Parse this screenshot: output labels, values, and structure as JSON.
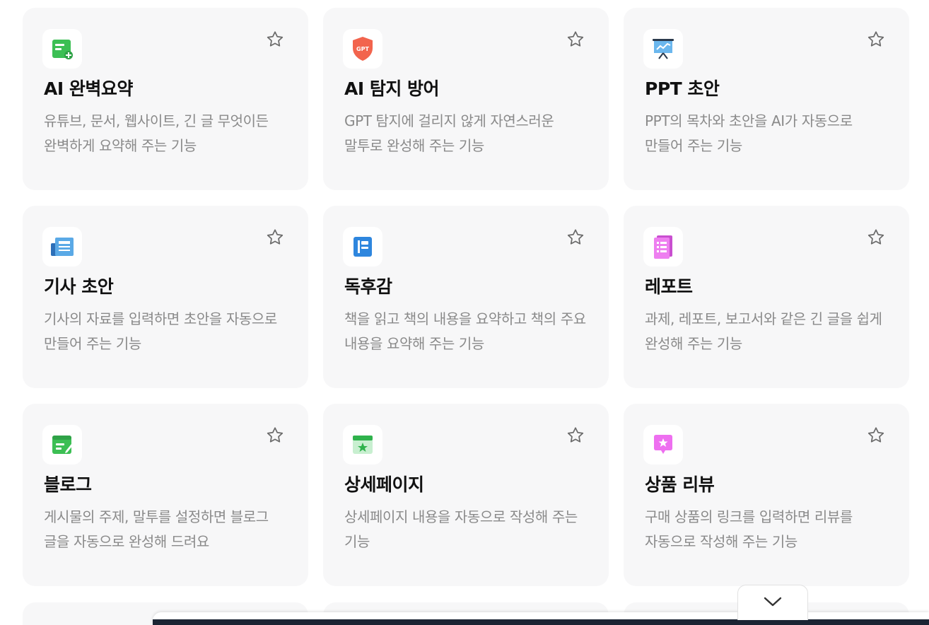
{
  "cards": [
    {
      "title": "AI 완벽요약",
      "desc": "유튜브, 문서, 웹사이트, 긴 글 무엇이든 완벽하게 요약해 주는 기능",
      "icon": "summary-icon",
      "color": "#3cbf54"
    },
    {
      "title": "AI 탐지 방어",
      "desc": "GPT 탐지에 걸리지 않게 자연스러운 말투로 완성해 주는 기능",
      "icon": "gpt-shield-icon",
      "color": "#f2644d",
      "icon_text": "GPT"
    },
    {
      "title": "PPT 초안",
      "desc": "PPT의 목차와 초안을 AI가 자동으로 만들어 주는 기능",
      "icon": "presentation-icon",
      "color": "#5aa9e6"
    },
    {
      "title": "기사 초안",
      "desc": "기사의 자료를 입력하면 초안을 자동으로 만들어 주는 기능",
      "icon": "newspaper-icon",
      "color": "#3d8fd9"
    },
    {
      "title": "독후감",
      "desc": "책을 읽고 책의 내용을 요약하고 책의 주요 내용을 요약해 주는 기능",
      "icon": "book-icon",
      "color": "#2e86de"
    },
    {
      "title": "레포트",
      "desc": "과제, 레포트, 보고서와 같은 긴 글을 쉽게 완성해 주는 기능",
      "icon": "report-icon",
      "color": "#e36ee8"
    },
    {
      "title": "블로그",
      "desc": "게시물의 주제, 말투를 설정하면 블로그 글을 자동으로 완성해 드려요",
      "icon": "blog-icon",
      "color": "#3cbf54"
    },
    {
      "title": "상세페이지",
      "desc": "상세페이지 내용을 자동으로 작성해 주는 기능",
      "icon": "detail-page-icon",
      "color": "#2fb24c"
    },
    {
      "title": "상품 리뷰",
      "desc": "구매 상품의 링크를 입력하면 리뷰를 자동으로 작성해 주는 기능",
      "icon": "review-icon",
      "color": "#ee6ff0"
    }
  ],
  "collapse_button": {
    "icon": "chevron-down-icon"
  }
}
